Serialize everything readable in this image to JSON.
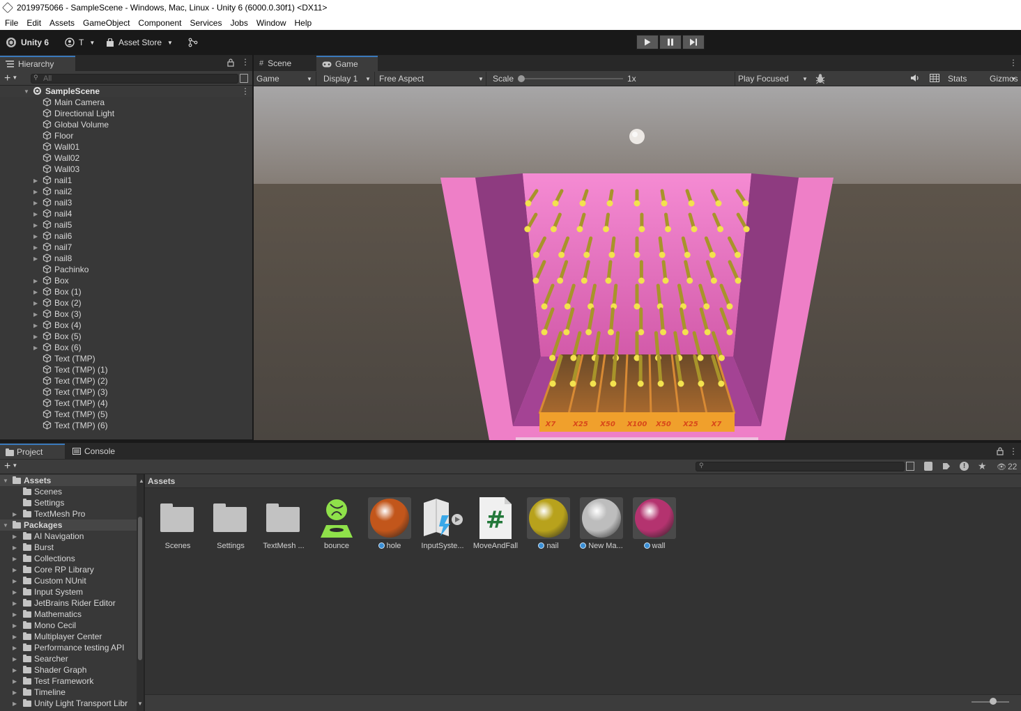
{
  "window": {
    "title": "2019975066 - SampleScene - Windows, Mac, Linux - Unity 6 (6000.0.30f1) <DX11>"
  },
  "menu": [
    "File",
    "Edit",
    "Assets",
    "GameObject",
    "Component",
    "Services",
    "Jobs",
    "Window",
    "Help"
  ],
  "toolbar": {
    "unity_label": "Unity 6",
    "account_label": "T",
    "asset_store_label": "Asset Store"
  },
  "hierarchy": {
    "tab_label": "Hierarchy",
    "search_placeholder": "All",
    "scene_name": "SampleScene",
    "items": [
      {
        "label": "Main Camera",
        "expandable": false
      },
      {
        "label": "Directional Light",
        "expandable": false
      },
      {
        "label": "Global Volume",
        "expandable": false
      },
      {
        "label": "Floor",
        "expandable": false
      },
      {
        "label": "Wall01",
        "expandable": false
      },
      {
        "label": "Wall02",
        "expandable": false
      },
      {
        "label": "Wall03",
        "expandable": false
      },
      {
        "label": "nail1",
        "expandable": true
      },
      {
        "label": "nail2",
        "expandable": true
      },
      {
        "label": "nail3",
        "expandable": true
      },
      {
        "label": "nail4",
        "expandable": true
      },
      {
        "label": "nail5",
        "expandable": true
      },
      {
        "label": "nail6",
        "expandable": true
      },
      {
        "label": "nail7",
        "expandable": true
      },
      {
        "label": "nail8",
        "expandable": true
      },
      {
        "label": "Pachinko",
        "expandable": false
      },
      {
        "label": "Box",
        "expandable": true
      },
      {
        "label": "Box (1)",
        "expandable": true
      },
      {
        "label": "Box (2)",
        "expandable": true
      },
      {
        "label": "Box (3)",
        "expandable": true
      },
      {
        "label": "Box (4)",
        "expandable": true
      },
      {
        "label": "Box (5)",
        "expandable": true
      },
      {
        "label": "Box (6)",
        "expandable": true
      },
      {
        "label": "Text (TMP)",
        "expandable": false
      },
      {
        "label": "Text (TMP) (1)",
        "expandable": false
      },
      {
        "label": "Text (TMP) (2)",
        "expandable": false
      },
      {
        "label": "Text (TMP) (3)",
        "expandable": false
      },
      {
        "label": "Text (TMP) (4)",
        "expandable": false
      },
      {
        "label": "Text (TMP) (5)",
        "expandable": false
      },
      {
        "label": "Text (TMP) (6)",
        "expandable": false
      }
    ]
  },
  "gameview": {
    "tabs": [
      "Scene",
      "Game"
    ],
    "game_dropdown": "Game",
    "display_dropdown": "Display 1",
    "aspect_dropdown": "Free Aspect",
    "scale_label": "Scale",
    "scale_value": "1x",
    "play_mode": "Play Focused",
    "stats_label": "Stats",
    "gizmos_label": "Gizmos",
    "multipliers": [
      "X7",
      "X25",
      "X50",
      "X100",
      "X50",
      "X25",
      "X7"
    ]
  },
  "project": {
    "tabs": [
      "Project",
      "Console"
    ],
    "visible_count": "22",
    "breadcrumb": "Assets",
    "tree": [
      {
        "label": "Assets",
        "level": 0,
        "bold": true,
        "expanded": true
      },
      {
        "label": "Scenes",
        "level": 1,
        "expandable": false
      },
      {
        "label": "Settings",
        "level": 1,
        "expandable": false
      },
      {
        "label": "TextMesh Pro",
        "level": 1,
        "expandable": true
      },
      {
        "label": "Packages",
        "level": 0,
        "bold": true,
        "expanded": true
      },
      {
        "label": "AI Navigation",
        "level": 1,
        "expandable": true
      },
      {
        "label": "Burst",
        "level": 1,
        "expandable": true
      },
      {
        "label": "Collections",
        "level": 1,
        "expandable": true
      },
      {
        "label": "Core RP Library",
        "level": 1,
        "expandable": true
      },
      {
        "label": "Custom NUnit",
        "level": 1,
        "expandable": true
      },
      {
        "label": "Input System",
        "level": 1,
        "expandable": true
      },
      {
        "label": "JetBrains Rider Editor",
        "level": 1,
        "expandable": true
      },
      {
        "label": "Mathematics",
        "level": 1,
        "expandable": true
      },
      {
        "label": "Mono Cecil",
        "level": 1,
        "expandable": true
      },
      {
        "label": "Multiplayer Center",
        "level": 1,
        "expandable": true
      },
      {
        "label": "Performance testing API",
        "level": 1,
        "expandable": true
      },
      {
        "label": "Searcher",
        "level": 1,
        "expandable": true
      },
      {
        "label": "Shader Graph",
        "level": 1,
        "expandable": true
      },
      {
        "label": "Test Framework",
        "level": 1,
        "expandable": true
      },
      {
        "label": "Timeline",
        "level": 1,
        "expandable": true
      },
      {
        "label": "Unity Light Transport Libr",
        "level": 1,
        "expandable": true
      }
    ],
    "assets": [
      {
        "label": "Scenes",
        "kind": "folder"
      },
      {
        "label": "Settings",
        "kind": "folder"
      },
      {
        "label": "TextMesh ...",
        "kind": "folder"
      },
      {
        "label": "bounce",
        "kind": "physics"
      },
      {
        "label": "hole",
        "kind": "material",
        "color": "#c2561b"
      },
      {
        "label": "InputSyste...",
        "kind": "input"
      },
      {
        "label": "MoveAndFall",
        "kind": "script"
      },
      {
        "label": "nail",
        "kind": "material",
        "color": "#b8a21c"
      },
      {
        "label": "New Ma...",
        "kind": "material",
        "color": "#bdbdbd"
      },
      {
        "label": "wall",
        "kind": "material",
        "color": "#b4336f"
      }
    ]
  }
}
